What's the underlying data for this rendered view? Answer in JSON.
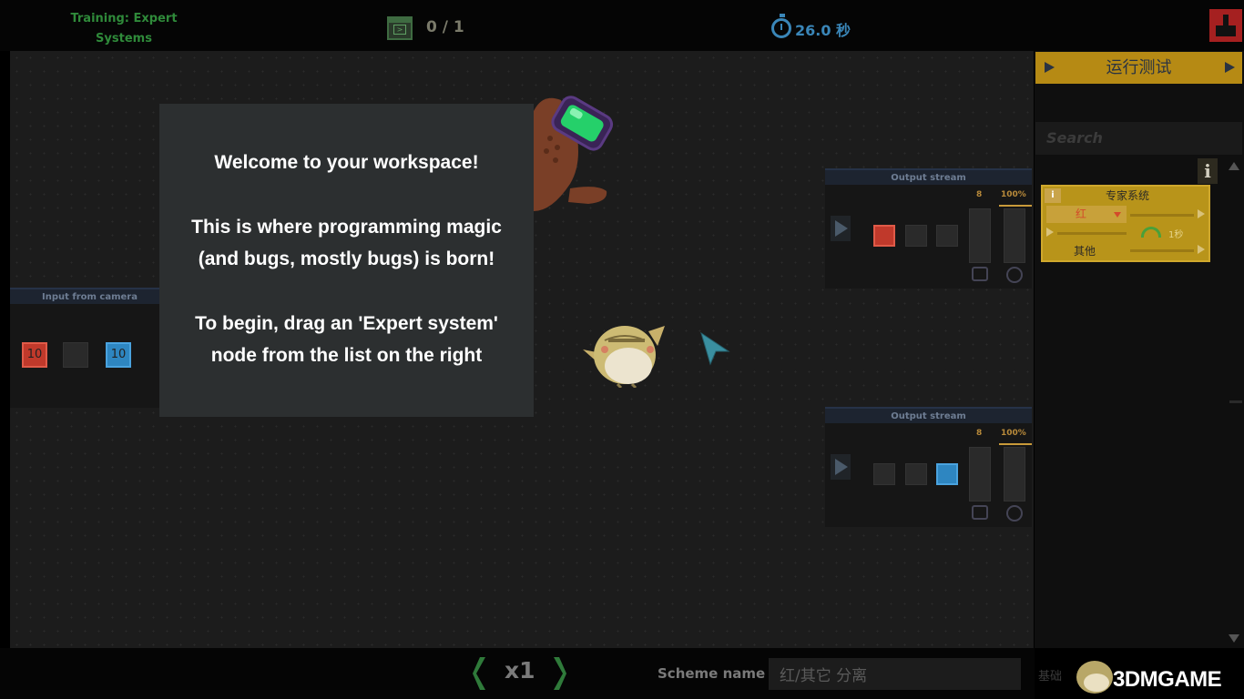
{
  "header": {
    "level_title_line1": "Training: Expert",
    "level_title_line2": "Systems",
    "progress": "0 / 1",
    "timer": "26.0 秒"
  },
  "nodes": {
    "input_camera": {
      "title": "Input from camera",
      "tiles": [
        {
          "value": "10",
          "color": "red"
        },
        {
          "value": "",
          "color": "empty"
        },
        {
          "value": "10",
          "color": "blue"
        }
      ]
    },
    "output_1": {
      "title": "Output stream",
      "count": "8",
      "percent": "100%",
      "tiles": [
        "red",
        "empty",
        "empty"
      ]
    },
    "output_2": {
      "title": "Output stream",
      "count": "8",
      "percent": "100%",
      "tiles": [
        "empty",
        "empty",
        "blue"
      ]
    }
  },
  "dialog": {
    "line1": "Welcome to your workspace!",
    "line2": "This is where programming magic",
    "line3": "(and bugs, mostly bugs) is born!",
    "line4": "To begin, drag an 'Expert system'",
    "line5": "node from the list on the right"
  },
  "right_panel": {
    "run_test_label": "运行测试",
    "search_placeholder": "Search",
    "info_icon_label": "i",
    "expert_card": {
      "info": "i",
      "title": "专家系统",
      "color_option": "红",
      "time": "1秒",
      "other_label": "其他"
    },
    "category_label": "基础"
  },
  "bottom": {
    "speed": "x1",
    "scheme_label": "Scheme name :",
    "scheme_value": "红/其它 分离"
  },
  "watermark": "3DMGAME",
  "colors": {
    "accent_gold": "#b68a14",
    "accent_blue": "#3a86b8",
    "tile_red": "#c0392b",
    "tile_blue": "#2e86c1",
    "level_green": "#2f8a3a"
  }
}
